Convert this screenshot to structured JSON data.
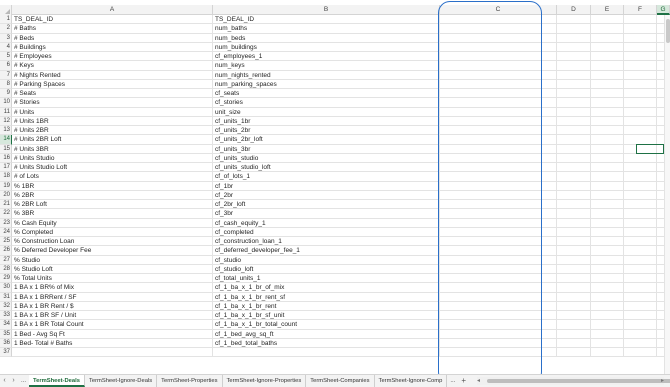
{
  "columns": [
    "A",
    "B",
    "C",
    "D",
    "E",
    "F",
    "G"
  ],
  "rows": [
    {
      "n": "1",
      "a": "TS_DEAL_ID",
      "b": "TS_DEAL_ID"
    },
    {
      "n": "2",
      "a": "# Baths",
      "b": "num_baths"
    },
    {
      "n": "3",
      "a": "# Beds",
      "b": "num_beds"
    },
    {
      "n": "4",
      "a": "# Buildings",
      "b": "num_buildings"
    },
    {
      "n": "5",
      "a": "# Employees",
      "b": "cf_employees_1"
    },
    {
      "n": "6",
      "a": "# Keys",
      "b": "num_keys"
    },
    {
      "n": "7",
      "a": "# Nights Rented",
      "b": "num_nights_rented"
    },
    {
      "n": "8",
      "a": "# Parking Spaces",
      "b": "num_parking_spaces"
    },
    {
      "n": "9",
      "a": "# Seats",
      "b": "cf_seats"
    },
    {
      "n": "10",
      "a": "# Stories",
      "b": "cf_stories"
    },
    {
      "n": "11",
      "a": "# Units",
      "b": "unit_size"
    },
    {
      "n": "12",
      "a": "# Units 1BR",
      "b": "cf_units_1br"
    },
    {
      "n": "13",
      "a": "# Units 2BR",
      "b": "cf_units_2br"
    },
    {
      "n": "14",
      "a": "# Units 2BR Loft",
      "b": "cf_units_2br_loft"
    },
    {
      "n": "15",
      "a": "# Units 3BR",
      "b": "cf_units_3br"
    },
    {
      "n": "16",
      "a": "# Units Studio",
      "b": "cf_units_studio"
    },
    {
      "n": "17",
      "a": "# Units Studio Loft",
      "b": "cf_units_studio_loft"
    },
    {
      "n": "18",
      "a": "# of Lots",
      "b": "cf_of_lots_1"
    },
    {
      "n": "19",
      "a": "% 1BR",
      "b": "cf_1br"
    },
    {
      "n": "20",
      "a": "% 2BR",
      "b": "cf_2br"
    },
    {
      "n": "21",
      "a": "% 2BR Loft",
      "b": "cf_2br_loft"
    },
    {
      "n": "22",
      "a": "% 3BR",
      "b": "cf_3br"
    },
    {
      "n": "23",
      "a": "% Cash Equity",
      "b": "cf_cash_equity_1"
    },
    {
      "n": "24",
      "a": "% Completed",
      "b": "cf_completed"
    },
    {
      "n": "25",
      "a": "% Construction Loan",
      "b": "cf_construction_loan_1"
    },
    {
      "n": "26",
      "a": "% Deferred Developer Fee",
      "b": "cf_deferred_developer_fee_1"
    },
    {
      "n": "27",
      "a": "% Studio",
      "b": "cf_studio"
    },
    {
      "n": "28",
      "a": "% Studio Loft",
      "b": "cf_studio_loft"
    },
    {
      "n": "29",
      "a": "% Total Units",
      "b": "cf_total_units_1"
    },
    {
      "n": "30",
      "a": "1 BA x 1 BR% of Mix",
      "b": "cf_1_ba_x_1_br_of_mix"
    },
    {
      "n": "31",
      "a": "1 BA x 1 BRRent / SF",
      "b": "cf_1_ba_x_1_br_rent_sf"
    },
    {
      "n": "32",
      "a": "1 BA x 1 BR Rent / $",
      "b": "cf_1_ba_x_1_br_rent"
    },
    {
      "n": "33",
      "a": "1 BA x 1 BR SF / Unit",
      "b": "cf_1_ba_x_1_br_sf_unit"
    },
    {
      "n": "34",
      "a": "1 BA x 1 BR Total Count",
      "b": "cf_1_ba_x_1_br_total_count"
    },
    {
      "n": "35",
      "a": "1 Bed - Avg Sq Ft",
      "b": "cf_1_bed_avg_sq_ft"
    },
    {
      "n": "36",
      "a": "1 Bed- Total # Baths",
      "b": "cf_1_bed_total_baths"
    },
    {
      "n": "37",
      "a": "",
      "b": ""
    }
  ],
  "selected_row": "14",
  "tabs": {
    "nav_prev": "‹",
    "nav_next": "›",
    "more_left": "...",
    "items": [
      "TermSheet-Deals",
      "TermSheet-Ignore-Deals",
      "TermSheet-Properties",
      "TermSheet-Ignore-Properties",
      "TermSheet-Companies",
      "TermSheet-Ignore-Comp"
    ],
    "more_right": "...",
    "add": "+"
  },
  "colors": {
    "selection": "#1e7145",
    "annotation_oval": "#2a6fc9"
  }
}
